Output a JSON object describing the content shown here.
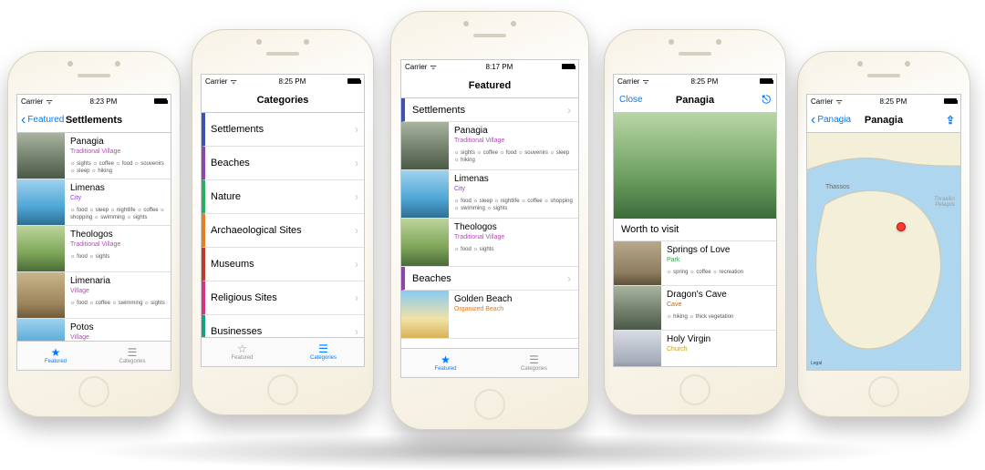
{
  "status": {
    "carrier": "Carrier",
    "wifi": "✦"
  },
  "tabs": {
    "featured": "Featured",
    "categories": "Categories"
  },
  "accent": "#007aff",
  "subtitleColors": {
    "village": "#b24db2",
    "city": "#8a3fd6",
    "park": "#3aa24a",
    "beach": "#e07a1f",
    "cave": "#b06c1a",
    "church": "#c7a21a"
  },
  "categoryColors": {
    "settlements": "#3f51b5",
    "beaches": "#8e44ad",
    "nature": "#27ae60",
    "archaeological": "#e67e22",
    "museums": "#c0392b",
    "religious": "#d63384",
    "businesses": "#16a085"
  },
  "phones": [
    {
      "id": "settlements",
      "time": "8:23 PM",
      "nav": {
        "title": "Settlements",
        "back": "Featured"
      },
      "activeTab": "featured",
      "rows": [
        {
          "title": "Panagia",
          "sub": "Traditional Village",
          "subColor": "village",
          "thumb": "g-stone",
          "tags": "☼ sights ☼ coffee ☼ food ☼ souvenirs ☼ sleep ☼ hiking"
        },
        {
          "title": "Limenas",
          "sub": "City",
          "subColor": "city",
          "thumb": "g-sea",
          "tags": "☼ food ☼ sleep ☼ nightlife ☼ coffee ☼ shopping ☼ swimming ☼ sights"
        },
        {
          "title": "Theologos",
          "sub": "Traditional Village",
          "subColor": "village",
          "thumb": "g-hill",
          "tags": "☼ food ☼ sights"
        },
        {
          "title": "Limenaria",
          "sub": "Village",
          "subColor": "village",
          "thumb": "g-town",
          "tags": "☼ food ☼ coffee ☼ swimming ☼ sights"
        },
        {
          "title": "Potos",
          "sub": "Village",
          "subColor": "village",
          "thumb": "g-sea",
          "tags": ""
        }
      ]
    },
    {
      "id": "categories",
      "time": "8:25 PM",
      "nav": {
        "title": "Categories"
      },
      "activeTab": "categories",
      "cats": [
        {
          "label": "Settlements",
          "c": "settlements"
        },
        {
          "label": "Beaches",
          "c": "beaches"
        },
        {
          "label": "Nature",
          "c": "nature"
        },
        {
          "label": "Archaeological Sites",
          "c": "archaeological"
        },
        {
          "label": "Museums",
          "c": "museums"
        },
        {
          "label": "Religious Sites",
          "c": "religious"
        },
        {
          "label": "Businesses",
          "c": "businesses"
        }
      ]
    },
    {
      "id": "featured",
      "time": "8:17 PM",
      "nav": {
        "title": "Featured"
      },
      "activeTab": "featured",
      "sections": [
        {
          "head": "Settlements",
          "stripe": "settlements",
          "rows": [
            {
              "title": "Panagia",
              "sub": "Traditional Village",
              "subColor": "village",
              "thumb": "g-stone",
              "tags": "☼ sights ☼ coffee ☼ food ☼ souvenirs ☼ sleep ☼ hiking"
            },
            {
              "title": "Limenas",
              "sub": "City",
              "subColor": "city",
              "thumb": "g-sea",
              "tags": "☼ food ☼ sleep ☼ nightlife ☼ coffee ☼ shopping ☼ swimming ☼ sights"
            },
            {
              "title": "Theologos",
              "sub": "Traditional Village",
              "subColor": "village",
              "thumb": "g-hill",
              "tags": "☼ food ☼ sights"
            }
          ]
        },
        {
          "head": "Beaches",
          "stripe": "beaches",
          "rows": [
            {
              "title": "Golden Beach",
              "sub": "Organized Beach",
              "subColor": "beach",
              "thumb": "g-sand",
              "tags": ""
            }
          ]
        }
      ]
    },
    {
      "id": "detail",
      "time": "8:25 PM",
      "nav": {
        "title": "Panagia",
        "close": "Close",
        "mapIcon": true
      },
      "hero": "g-green",
      "worthHeader": "Worth to visit",
      "rows": [
        {
          "title": "Springs of Love",
          "sub": "Park",
          "subColor": "park",
          "thumb": "g-ruin",
          "tags": "☼ spring ☼ coffee ☼ recreation"
        },
        {
          "title": "Dragon's Cave",
          "sub": "Cave",
          "subColor": "cave",
          "thumb": "g-stone",
          "tags": "☼ hiking ☼ thick vegetation"
        },
        {
          "title": "Holy Virgin",
          "sub": "Church",
          "subColor": "church",
          "thumb": "g-church",
          "tags": ""
        }
      ]
    },
    {
      "id": "map",
      "time": "8:25 PM",
      "nav": {
        "title": "Panagia",
        "back": "Panagia",
        "shareIcon": true
      },
      "island": "Thassos",
      "sea": "Thrakiko Pelagos",
      "legal": "Legal"
    }
  ]
}
